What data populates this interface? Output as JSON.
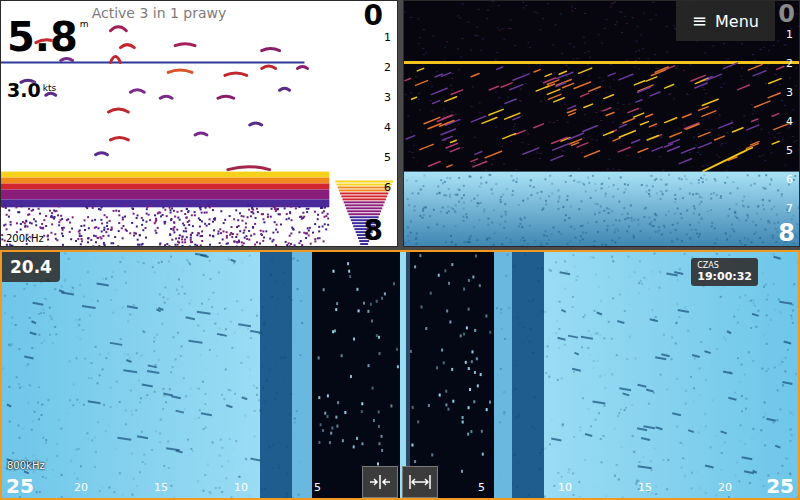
{
  "sonar": {
    "title": "Active 3 in 1 prawy",
    "selected": false,
    "depth": "5.8",
    "depth_unit": "m",
    "speed": "3.0",
    "speed_unit": "kts",
    "range_top": "0",
    "range_bottom": "8",
    "scale": [
      "1",
      "2",
      "3",
      "4",
      "5",
      "6"
    ],
    "frequency": "200kHz"
  },
  "downscan": {
    "selected": false,
    "menu": {
      "icon": "≡",
      "label": "Menu"
    },
    "range_top": "0",
    "range_bottom": "8",
    "scale": [
      "1",
      "2",
      "3",
      "4",
      "5",
      "6",
      "7"
    ]
  },
  "sidescan": {
    "selected": true,
    "reading": "20.4",
    "time_label": "CZAS",
    "time": "19:00:32",
    "frequency": "800kHz",
    "scale_left": [
      "25",
      "20",
      "15",
      "10",
      "5"
    ],
    "scale_right": [
      "5",
      "10",
      "15",
      "20",
      "25"
    ]
  }
}
